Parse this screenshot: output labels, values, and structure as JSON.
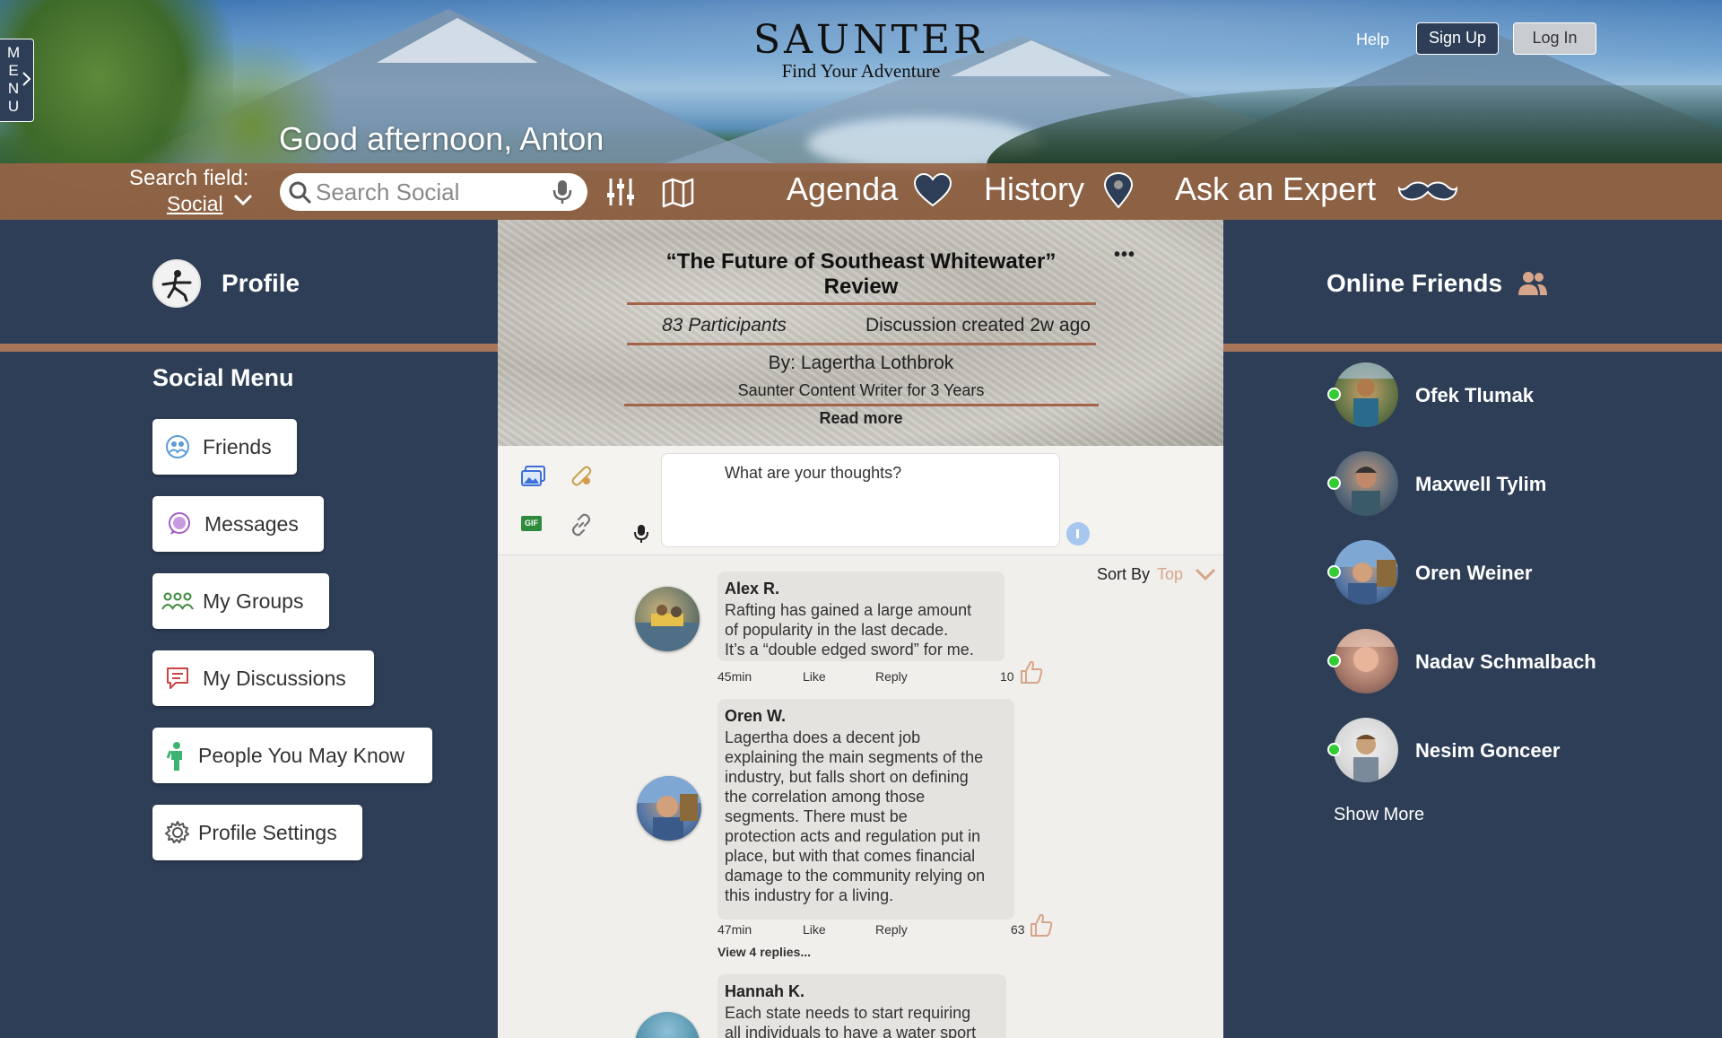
{
  "header": {
    "menu_tab_letters": "MENU",
    "logo_title": "SAUNTER",
    "logo_tagline": "Find Your Adventure",
    "help_link": "Help",
    "signup_button": "Sign Up",
    "login_button": "Log In",
    "greeting": "Good afternoon, Anton"
  },
  "nav": {
    "search_field_label": "Search field:",
    "search_field_value": "Social",
    "search_placeholder": "Search Social",
    "agenda": "Agenda",
    "history": "History",
    "ask_expert": "Ask an Expert",
    "icons": [
      "search-icon",
      "microphone-icon",
      "filter-sliders-icon",
      "map-icon",
      "heart-icon",
      "map-pin-icon",
      "mustache-icon"
    ]
  },
  "left_sidebar": {
    "profile_label": "Profile",
    "social_menu_title": "Social Menu",
    "items": [
      {
        "label": "Friends",
        "icon": "friends-icon",
        "color": "#5b9bd5"
      },
      {
        "label": "Messages",
        "icon": "messages-icon",
        "color": "#a35cc7"
      },
      {
        "label": "My Groups",
        "icon": "groups-icon",
        "color": "#3d8a3d"
      },
      {
        "label": "My Discussions",
        "icon": "discussions-icon",
        "color": "#c44"
      },
      {
        "label": "People You May Know",
        "icon": "person-icon",
        "color": "#3cb371"
      },
      {
        "label": "Profile Settings",
        "icon": "gear-icon",
        "color": "#555"
      }
    ]
  },
  "discussion": {
    "title": "“The Future of Southeast Whitewater” Review",
    "more": "•••",
    "participants": "83 Participants",
    "created": "Discussion created 2w ago",
    "by": "By: Lagertha Lothbrok",
    "role": "Saunter Content Writer for 3 Years",
    "read_more": "Read more"
  },
  "composer": {
    "placeholder": "What are your thoughts?",
    "gif_label": "GIF"
  },
  "sort": {
    "label": "Sort By",
    "value": "Top"
  },
  "comments": [
    {
      "author": "Alex R.",
      "lines": [
        "Rafting has gained a large amount",
        "of popularity in the last decade.",
        "It’s a “double edged sword” for me."
      ],
      "time": "45min",
      "like": "Like",
      "reply": "Reply",
      "likes": "10"
    },
    {
      "author": "Oren W.",
      "lines": [
        "Lagertha does a decent job",
        "explaining the main segments of the",
        "industry, but falls short on defining",
        "the correlation among those",
        "segments. There must be",
        "protection acts and regulation put in",
        "place, but with that comes financial",
        "damage to the community relying on",
        "this industry for a living."
      ],
      "time": "47min",
      "like": "Like",
      "reply": "Reply",
      "likes": "63",
      "view_replies": "View 4 replies..."
    },
    {
      "author": "Hannah K.",
      "lines": [
        "Each state needs to start requiring",
        "all individuals to have a water sport"
      ]
    }
  ],
  "right_sidebar": {
    "title": "Online Friends",
    "friends": [
      "Ofek Tlumak",
      "Maxwell Tylim",
      "Oren Weiner",
      "Nadav Schmalbach",
      "Nesim Gonceer"
    ],
    "show_more": "Show More",
    "online_color": "#33cc33"
  },
  "colors": {
    "page_bg": "#2d3e56",
    "nav_bar": "#96644600",
    "accent_rule": "#a8765a",
    "sort_accent": "#d7a58a"
  }
}
